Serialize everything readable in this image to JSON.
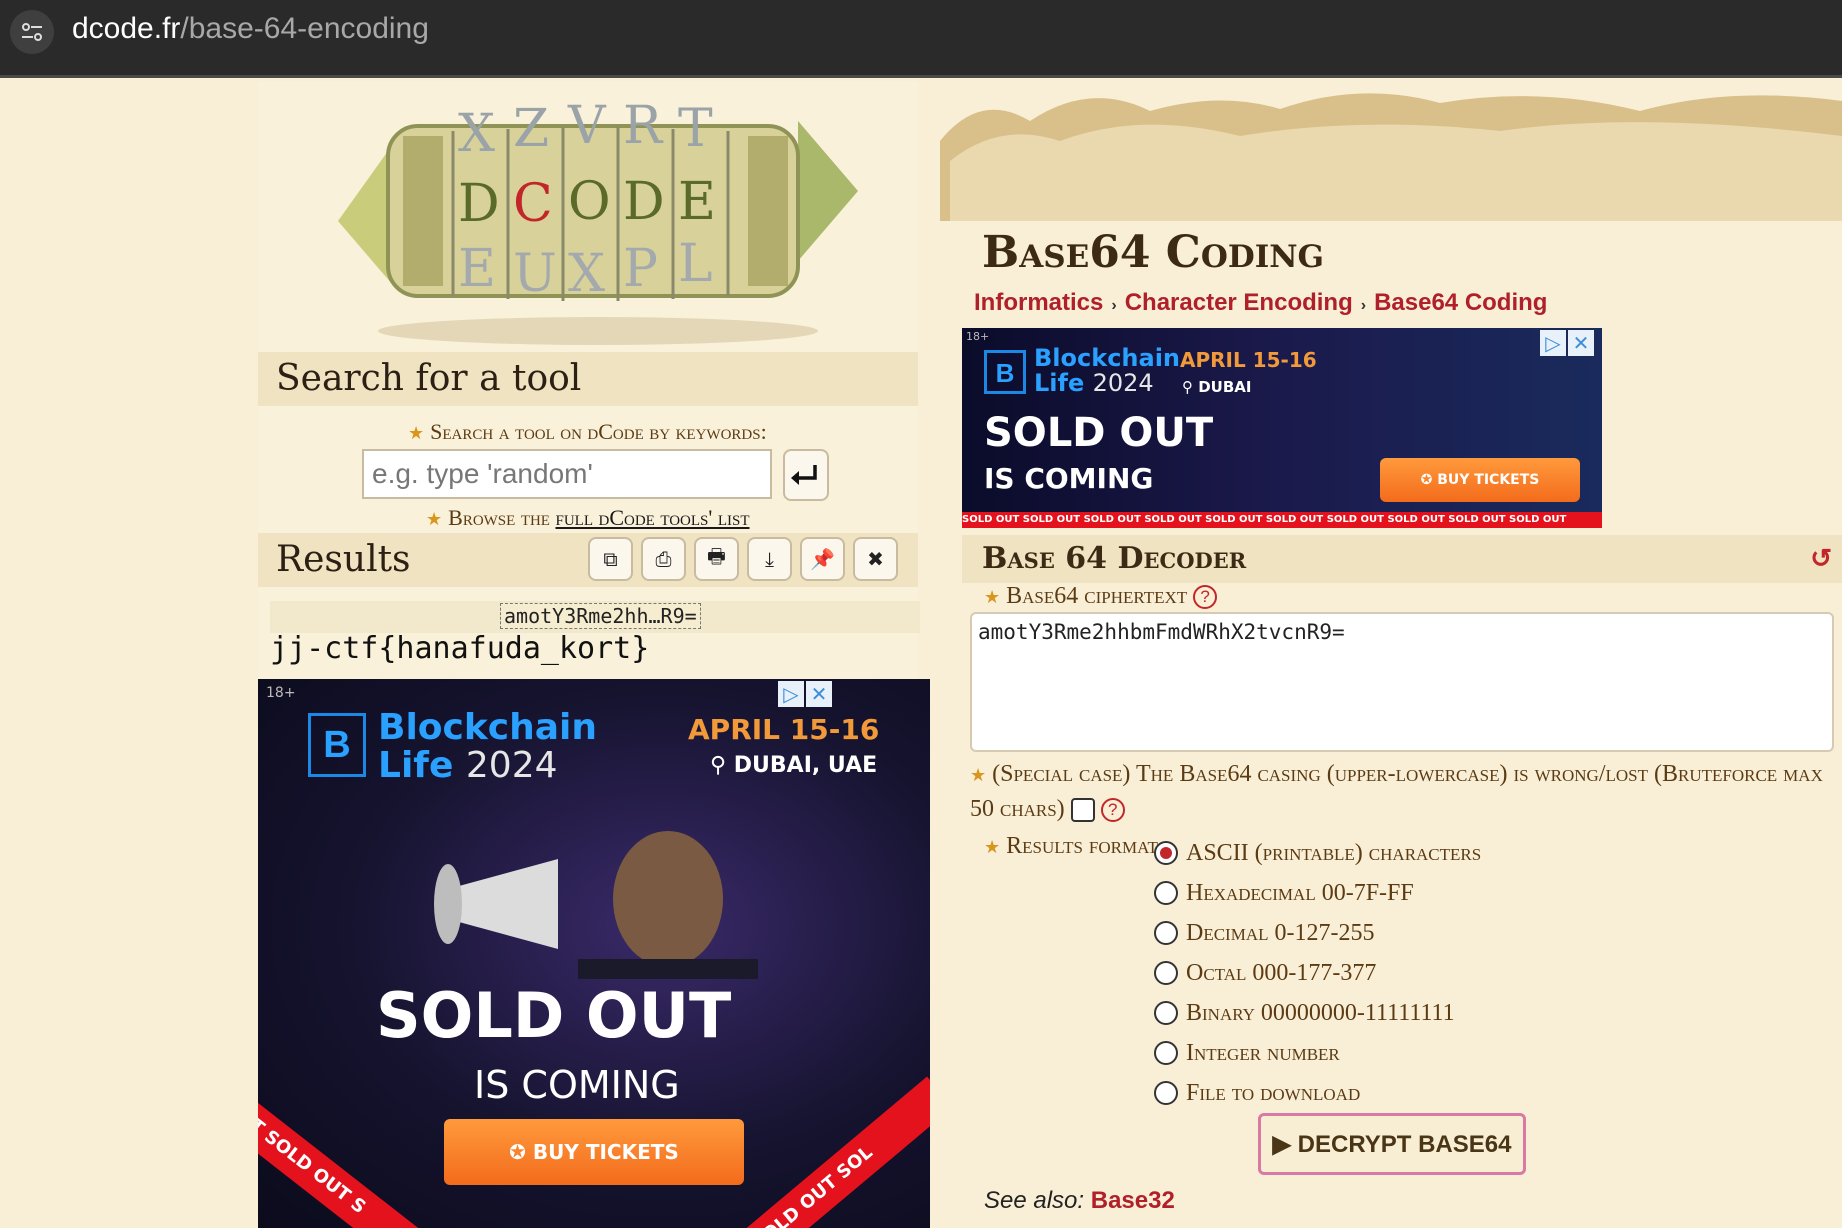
{
  "browser": {
    "url_domain": "dcode.fr",
    "url_path": "/base-64-encoding"
  },
  "logo": {
    "rows": [
      "X Z V R T",
      "D C O D E",
      "E U X P L"
    ]
  },
  "search": {
    "title": "Search for a tool",
    "hint": "Search a tool on dCode by keywords:",
    "placeholder": "e.g. type 'random'",
    "browse_prefix": "Browse the ",
    "browse_link": "full dCode tools' list"
  },
  "results": {
    "title": "Results",
    "tools": [
      "⧉",
      "⎙",
      "🖶",
      "⤓",
      "📌",
      "✖"
    ],
    "input_short": "amotY3Rme2hh…R9=",
    "decoded": "jj-ctf{hanafuda_kort}"
  },
  "ad": {
    "age": "18+",
    "brand": "Blockchain",
    "brand2": "Life",
    "year": "2024",
    "date": "APRIL 15-16",
    "place_left": "DUBAI, UAE",
    "place_top": "DUBAI",
    "headline": "SOLD OUT",
    "subline": "IS COMING",
    "cta": "BUY TICKETS",
    "strip": "SOLD OUT  SOLD OUT  SOLD OUT  SOLD OUT  SOLD OUT  SOLD OUT  SOLD OUT  SOLD OUT  SOLD OUT  SOLD OUT",
    "strip_left": "UT SOLD OUT S",
    "strip_right": "SOLD OUT SOL"
  },
  "page": {
    "title": "Base64 Coding",
    "breadcrumb": [
      "Informatics",
      "Character Encoding",
      "Base64 Coding"
    ]
  },
  "decoder": {
    "title": "Base 64 Decoder",
    "cipher_label": "Base64 ciphertext",
    "cipher_value": "amotY3Rme2hhbmFmdWRhX2tvcnR9=",
    "special_case": "(Special case) The Base64 casing (upper-lowercase) is wrong/lost (Bruteforce max 50 chars)",
    "format_label": "Results format",
    "formats": [
      "ASCII (printable) characters",
      "Hexadecimal 00-7F-FF",
      "Decimal 0-127-255",
      "Octal 000-177-377",
      "Binary 00000000-11111111",
      "Integer number",
      "File to download"
    ],
    "selected_format": "ASCII (printable) characters",
    "button": "▶ DECRYPT BASE64",
    "see_also_label": "See also: ",
    "see_also_link": "Base32"
  },
  "colors": {
    "link": "#b0202a",
    "background": "#f8efd6",
    "accent_star": "#d9951c"
  }
}
